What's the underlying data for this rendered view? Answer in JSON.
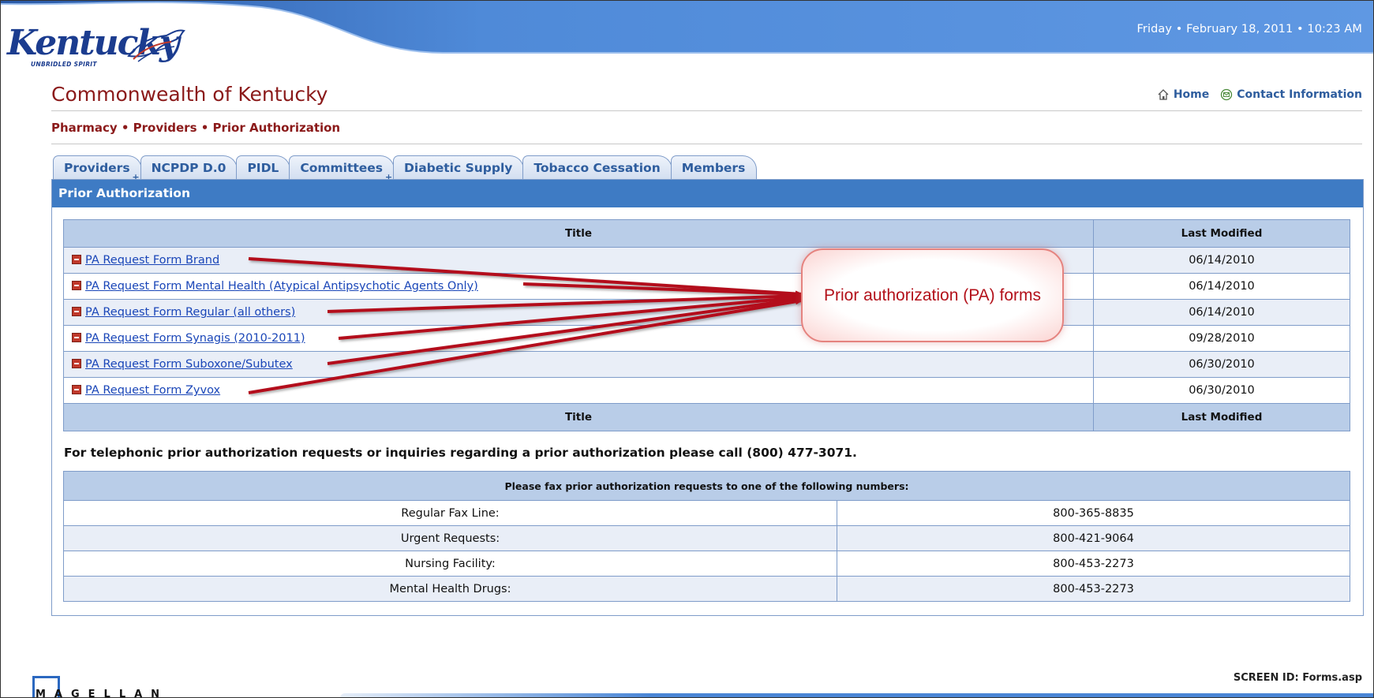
{
  "header": {
    "datetime": "Friday • February 18, 2011 • 10:23 AM",
    "logo_word": "Kentucky",
    "logo_tagline": "UNBRIDLED SPIRIT",
    "site_title": "Commonwealth of Kentucky",
    "links": {
      "home": "Home",
      "contact": "Contact Information"
    },
    "breadcrumb": "Pharmacy • Providers • Prior Authorization"
  },
  "tabs": [
    {
      "label": "Providers",
      "has_submenu": true
    },
    {
      "label": "NCPDP D.0",
      "has_submenu": false
    },
    {
      "label": "PIDL",
      "has_submenu": false
    },
    {
      "label": "Committees",
      "has_submenu": true
    },
    {
      "label": "Diabetic Supply",
      "has_submenu": false
    },
    {
      "label": "Tobacco Cessation",
      "has_submenu": false
    },
    {
      "label": "Members",
      "has_submenu": false
    }
  ],
  "tab_submenu_marker": "+",
  "panel": {
    "title": "Prior Authorization",
    "forms_table": {
      "col_title": "Title",
      "col_modified": "Last Modified",
      "rows": [
        {
          "title": "PA Request Form Brand",
          "modified": "06/14/2010"
        },
        {
          "title": "PA Request Form Mental Health (Atypical Antipsychotic Agents Only)",
          "modified": "06/14/2010"
        },
        {
          "title": "PA Request Form Regular (all others)",
          "modified": "06/14/2010"
        },
        {
          "title": "PA Request Form Synagis (2010-2011)",
          "modified": "09/28/2010"
        },
        {
          "title": "PA Request Form Suboxone/Subutex",
          "modified": "06/30/2010"
        },
        {
          "title": "PA Request Form Zyvox",
          "modified": "06/30/2010"
        }
      ]
    },
    "phone_note": "For telephonic prior authorization requests or inquiries regarding a prior authorization please call (800) 477-3071.",
    "fax_table": {
      "header": "Please fax prior authorization requests to one of the following numbers:",
      "rows": [
        {
          "label": "Regular Fax Line:",
          "number": "800-365-8835"
        },
        {
          "label": "Urgent Requests:",
          "number": "800-421-9064"
        },
        {
          "label": "Nursing Facility:",
          "number": "800-453-2273"
        },
        {
          "label": "Mental Health Drugs:",
          "number": "800-453-2273"
        }
      ]
    }
  },
  "annotation": {
    "text": "Prior authorization (PA) forms",
    "color": "#b3111a"
  },
  "footer": {
    "screen_id": "SCREEN ID: Forms.asp",
    "vendor_logo": "MAGELLAN"
  },
  "icons": {
    "home": "home-icon",
    "contact": "envelope-icon",
    "form": "pdf-icon"
  },
  "colors": {
    "brand_blue": "#3e7bc4",
    "title_red": "#8b1a1a",
    "link_blue": "#1a46b8"
  }
}
